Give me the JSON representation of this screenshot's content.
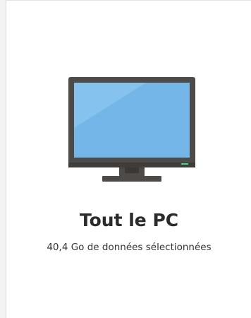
{
  "card": {
    "title": "Tout le PC",
    "subtitle": "40,4 Go de données sélectionnées",
    "icon": "desktop-monitor-icon"
  },
  "colors": {
    "background": "#ffffff",
    "screen": "#74b6e7",
    "bezel": "#4d4a48",
    "power_led": "#3ddc84"
  }
}
